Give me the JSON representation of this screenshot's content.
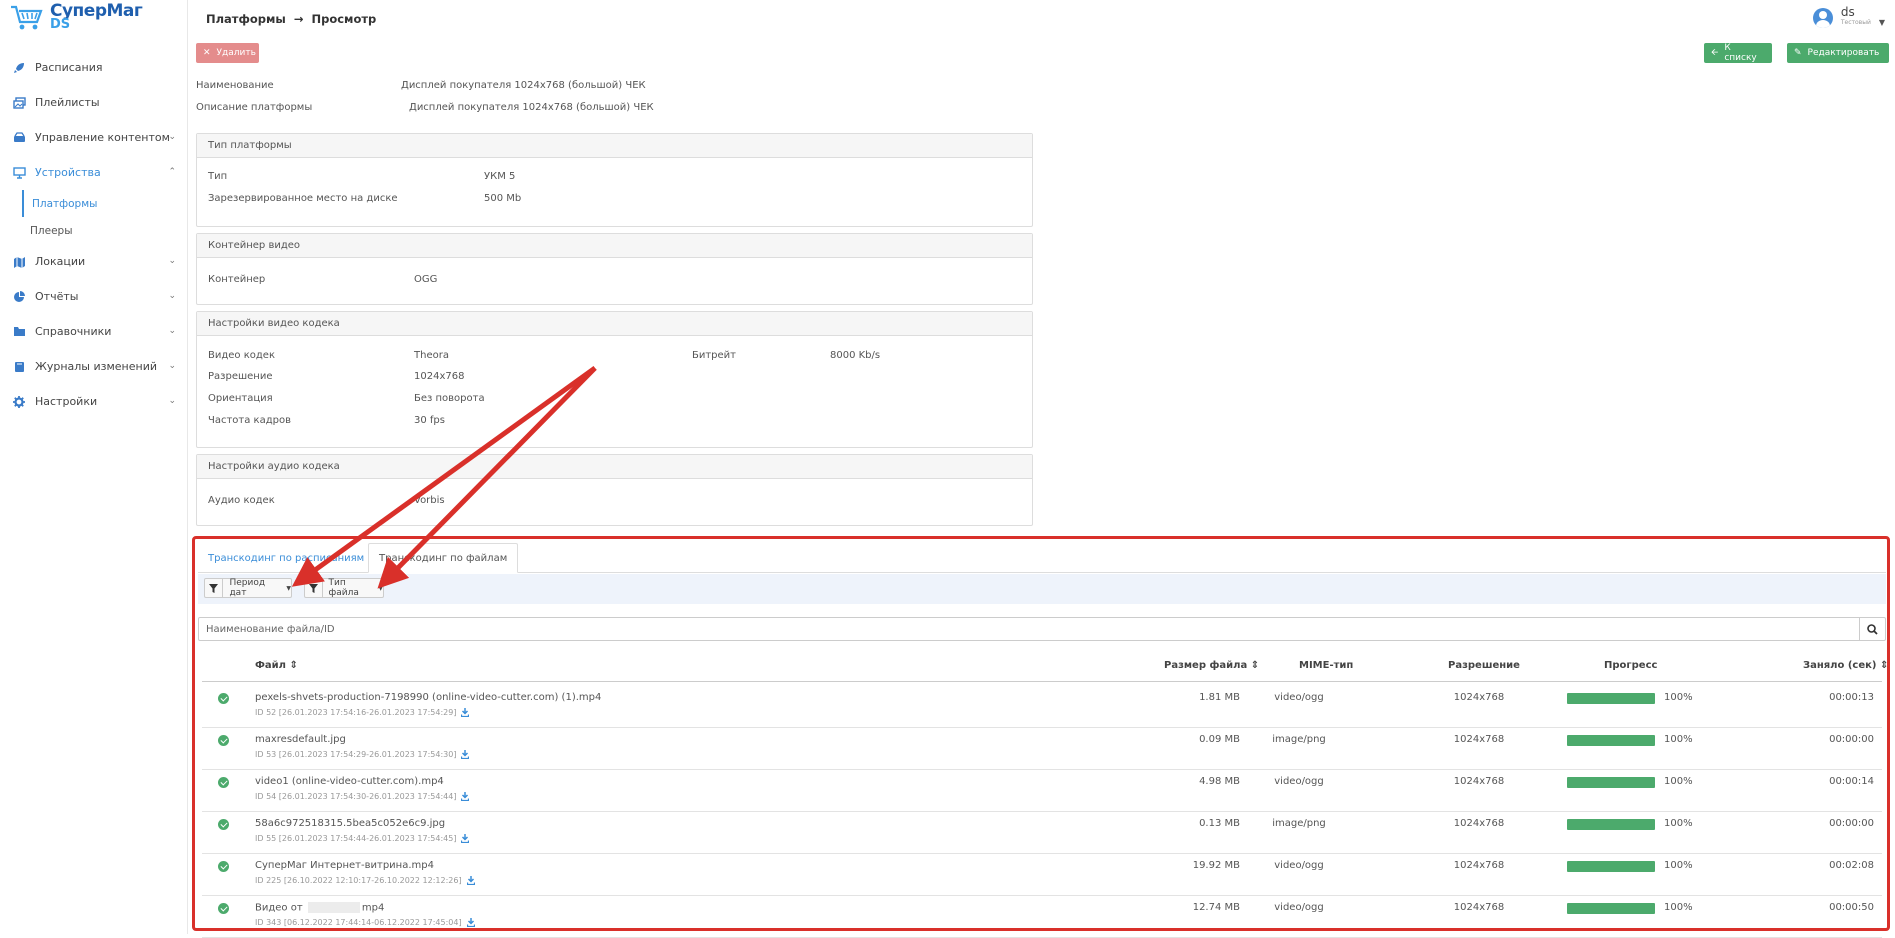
{
  "app": {
    "logo_line1": "СуперМаг",
    "logo_line2": "DS"
  },
  "sidebar": {
    "items": [
      {
        "label": "Расписания",
        "icon": "rocket-icon",
        "expandable": false
      },
      {
        "label": "Плейлисты",
        "icon": "images-icon",
        "expandable": false
      },
      {
        "label": "Управление контентом",
        "icon": "hdd-icon",
        "expandable": true
      },
      {
        "label": "Устройства",
        "icon": "desktop-icon",
        "expandable": true,
        "active": true,
        "children": [
          {
            "label": "Платформы",
            "active": true
          },
          {
            "label": "Плееры"
          }
        ]
      },
      {
        "label": "Локации",
        "icon": "map-icon",
        "expandable": true
      },
      {
        "label": "Отчёты",
        "icon": "pie-chart-icon",
        "expandable": true
      },
      {
        "label": "Справочники",
        "icon": "folder-icon",
        "expandable": true
      },
      {
        "label": "Журналы изменений",
        "icon": "book-icon",
        "expandable": true
      },
      {
        "label": "Настройки",
        "icon": "gear-icon",
        "expandable": true
      }
    ]
  },
  "header": {
    "breadcrumb": [
      "Платформы",
      "Просмотр"
    ],
    "user": {
      "name": "ds",
      "role": "Тестовый"
    }
  },
  "toolbar": {
    "delete_label": "Удалить",
    "back_label": "К списку",
    "edit_label": "Редактировать"
  },
  "platform": {
    "name_label": "Наименование",
    "name_value": "Дисплей покупателя 1024x768 (большой) ЧЕК",
    "desc_label": "Описание платформы",
    "desc_value": "Дисплей покупателя 1024x768 (большой) ЧЕК"
  },
  "cards": {
    "platform_type": {
      "title": "Тип платформы",
      "type_label": "Тип",
      "type_value": "УКМ 5",
      "disk_label": "Зарезервированное место на диске",
      "disk_value": "500 Mb"
    },
    "video_container": {
      "title": "Контейнер видео",
      "container_label": "Контейнер",
      "container_value": "OGG"
    },
    "video_codec": {
      "title": "Настройки видео кодека",
      "codec_label": "Видео кодек",
      "codec_value": "Theora",
      "bitrate_label": "Битрейт",
      "bitrate_value": "8000 Kb/s",
      "res_label": "Разрешение",
      "res_value": "1024x768",
      "orient_label": "Ориентация",
      "orient_value": "Без поворота",
      "fps_label": "Частота кадров",
      "fps_value": "30 fps"
    },
    "audio_codec": {
      "title": "Настройки аудио кодека",
      "codec_label": "Аудио кодек",
      "codec_value": "Vorbis"
    }
  },
  "transcoding": {
    "tabs": [
      {
        "label": "Транскодинг по расписаниям",
        "active": false
      },
      {
        "label": "Транскодинг по файлам",
        "active": true
      }
    ],
    "filters": {
      "date_label": "Период дат",
      "type_label": "Тип файла"
    },
    "search_placeholder": "Наименование файла/ID",
    "columns": {
      "file": "Файл",
      "size": "Размер файла",
      "mime": "MIME-тип",
      "res": "Разрешение",
      "progress": "Прогресс",
      "took": "Заняло (сек)"
    },
    "rows": [
      {
        "name": "pexels-shvets-production-7198990 (online-video-cutter.com) (1).mp4",
        "meta": "ID 52 [26.01.2023 17:54:16-26.01.2023 17:54:29]",
        "size": "1.81 MB",
        "mime": "video/ogg",
        "res": "1024x768",
        "progress": 1.0,
        "progress_label": "100%",
        "took": "00:00:13"
      },
      {
        "name": "maxresdefault.jpg",
        "meta": "ID 53 [26.01.2023 17:54:29-26.01.2023 17:54:30]",
        "size": "0.09 MB",
        "mime": "image/png",
        "res": "1024x768",
        "progress": 1.0,
        "progress_label": "100%",
        "took": "00:00:00"
      },
      {
        "name": "video1 (online-video-cutter.com).mp4",
        "meta": "ID 54 [26.01.2023 17:54:30-26.01.2023 17:54:44]",
        "size": "4.98 MB",
        "mime": "video/ogg",
        "res": "1024x768",
        "progress": 1.0,
        "progress_label": "100%",
        "took": "00:00:14"
      },
      {
        "name": "58a6c972518315.5bea5c052e6c9.jpg",
        "meta": "ID 55 [26.01.2023 17:54:44-26.01.2023 17:54:45]",
        "size": "0.13 MB",
        "mime": "image/png",
        "res": "1024x768",
        "progress": 1.0,
        "progress_label": "100%",
        "took": "00:00:00"
      },
      {
        "name": "СуперМаг Интернет-витрина.mp4",
        "meta": "ID 225 [26.10.2022 12:10:17-26.10.2022 12:12:26]",
        "size": "19.92 MB",
        "mime": "video/ogg",
        "res": "1024x768",
        "progress": 1.0,
        "progress_label": "100%",
        "took": "00:02:08"
      },
      {
        "name_prefix": "Видео от",
        "name_suffix": "mp4",
        "meta": "ID 343 [06.12.2022 17:44:14-06.12.2022 17:45:04]",
        "size": "12.74 MB",
        "mime": "video/ogg",
        "res": "1024x768",
        "progress": 1.0,
        "progress_label": "100%",
        "took": "00:00:50"
      }
    ]
  },
  "colors": {
    "accent": "#3a8dd8",
    "success": "#4caa6c",
    "danger": "#e48c8c",
    "annotation": "#d9302a"
  }
}
